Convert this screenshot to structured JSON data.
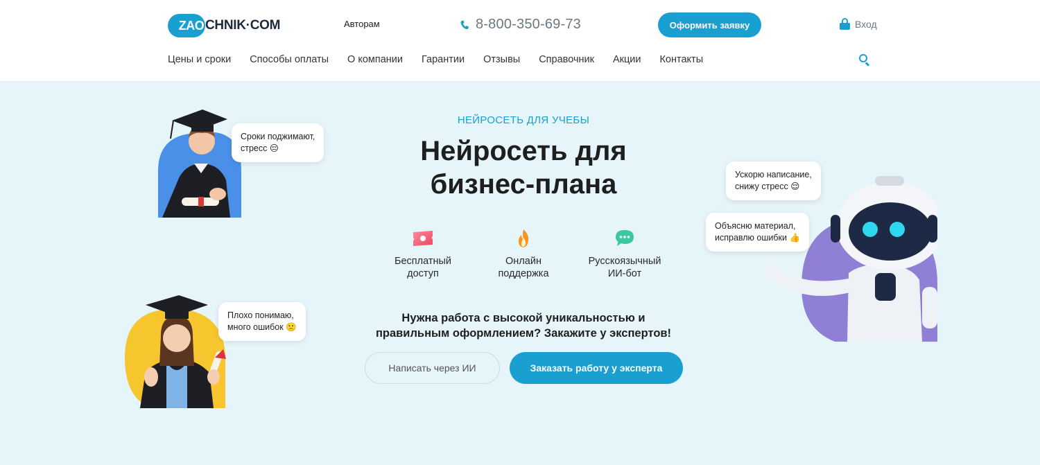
{
  "header": {
    "logo": {
      "badge": "ZAO",
      "text": "CHNIK·COM"
    },
    "authors_link": "Авторам",
    "phone": "8-800-350-69-73",
    "apply_button": "Оформить заявку",
    "login": "Вход",
    "nav": [
      "Цены и сроки",
      "Способы оплаты",
      "О компании",
      "Гарантии",
      "Отзывы",
      "Справочник",
      "Акции",
      "Контакты"
    ]
  },
  "hero": {
    "eyebrow": "НЕЙРОСЕТЬ ДЛЯ УЧЕБЫ",
    "title_line1": "Нейросеть для",
    "title_line2": "бизнес-плана",
    "features": [
      {
        "icon": "ticket-icon",
        "label": "Бесплатный\nдоступ"
      },
      {
        "icon": "flame-icon",
        "label": "Онлайн\nподдержка"
      },
      {
        "icon": "chat-icon",
        "label": "Русскоязычный\nИИ-бот"
      }
    ],
    "cta_text": "Нужна работа с высокой уникальностью и\nправильным оформлением? Закажите у экспертов!",
    "button_ai": "Написать через ИИ",
    "button_expert": "Заказать работу у эксперта"
  },
  "bubbles": {
    "student_top": "Сроки поджимают,\nстресс 😔",
    "student_bottom": "Плохо понимаю,\nмного ошибок 🙁",
    "robot_top": "Ускорю написание,\nснижу стресс 😌",
    "robot_bottom": "Объясню материал,\nисправлю ошибки 👍"
  },
  "colors": {
    "accent": "#1a9fd1",
    "hero_bg": "#e6f5fa",
    "student_top_circle": "#4a8fe8",
    "student_bottom_circle": "#f7c62f",
    "robot_circle": "#8f80d6"
  }
}
